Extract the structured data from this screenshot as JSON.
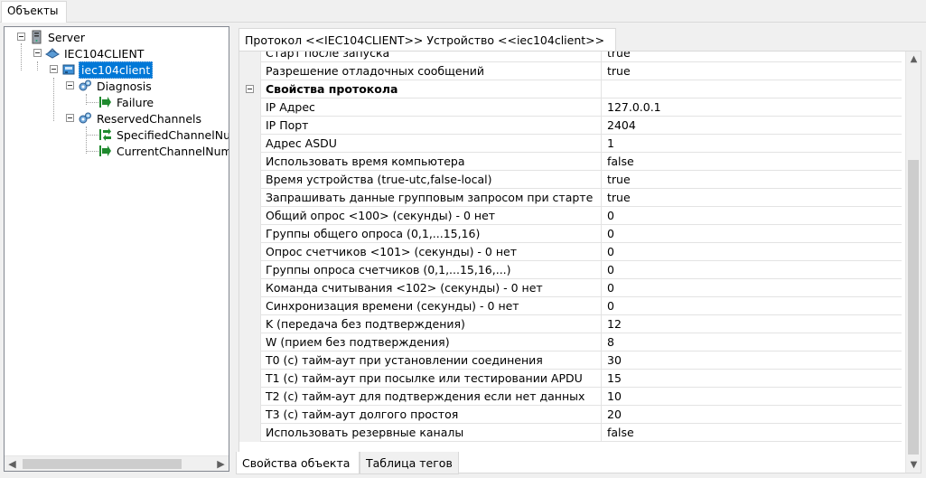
{
  "top_tab": {
    "label": "Объекты"
  },
  "tree": {
    "nodes": [
      {
        "label": "Server",
        "icon": "server-icon"
      },
      {
        "label": "IEC104CLIENT",
        "icon": "driver-icon"
      },
      {
        "label": "iec104client",
        "icon": "device-icon",
        "selected": true
      },
      {
        "label": "Diagnosis",
        "icon": "gears-icon"
      },
      {
        "label": "Failure",
        "icon": "tag-arrow-icon"
      },
      {
        "label": "ReservedChannels",
        "icon": "gears-icon"
      },
      {
        "label": "SpecifiedChannelNum",
        "icon": "tag-arrows-icon"
      },
      {
        "label": "CurrentChannelNum",
        "icon": "tag-arrow-icon"
      }
    ]
  },
  "doc_tab": {
    "label": "Протокол <<IEC104CLIENT>> Устройство <<iec104client>>"
  },
  "grid": {
    "rows": [
      {
        "name": "Старт после запуска",
        "value": "true"
      },
      {
        "name": "Разрешение отладочных сообщений",
        "value": "true"
      },
      {
        "name": "Свойства протокола",
        "value": "",
        "category": true
      },
      {
        "name": "IP Адрес",
        "value": "127.0.0.1"
      },
      {
        "name": "IP Порт",
        "value": "2404"
      },
      {
        "name": "Адрес ASDU",
        "value": "1"
      },
      {
        "name": "Использовать время компьютера",
        "value": "false"
      },
      {
        "name": "Время устройства (true-utc,false-local)",
        "value": "true"
      },
      {
        "name": "Запрашивать данные групповым запросом при старте",
        "value": "true"
      },
      {
        "name": "Общий опрос <100> (секунды) - 0 нет",
        "value": "0"
      },
      {
        "name": "Группы общего опроса (0,1,...15,16)",
        "value": "0"
      },
      {
        "name": "Опрос счетчиков <101> (секунды) - 0 нет",
        "value": "0"
      },
      {
        "name": "Группы опроса счетчиков (0,1,...15,16,...)",
        "value": "0"
      },
      {
        "name": "Команда считывания <102> (секунды) - 0 нет",
        "value": "0"
      },
      {
        "name": "Синхронизация времени (секунды) - 0 нет",
        "value": "0"
      },
      {
        "name": "K (передача без подтверждения)",
        "value": "12"
      },
      {
        "name": "W (прием без подтверждения)",
        "value": "8"
      },
      {
        "name": "T0 (с) тайм-аут при установлении соединения",
        "value": "30"
      },
      {
        "name": "T1 (с) тайм-аут при посылке или тестировании APDU",
        "value": "15"
      },
      {
        "name": "T2 (с) тайм-аут для подтверждения если нет данных",
        "value": "10"
      },
      {
        "name": "T3 (с) тайм-аут долгого простоя",
        "value": "20"
      },
      {
        "name": "Использовать резервные каналы",
        "value": "false"
      }
    ]
  },
  "bottom_tabs": [
    {
      "label": "Свойства объекта",
      "active": true
    },
    {
      "label": "Таблица тегов",
      "active": false
    }
  ],
  "colors": {
    "selection": "#0078d7",
    "grid_line": "#e3e3e3",
    "tag_green": "#1f8a2e"
  }
}
